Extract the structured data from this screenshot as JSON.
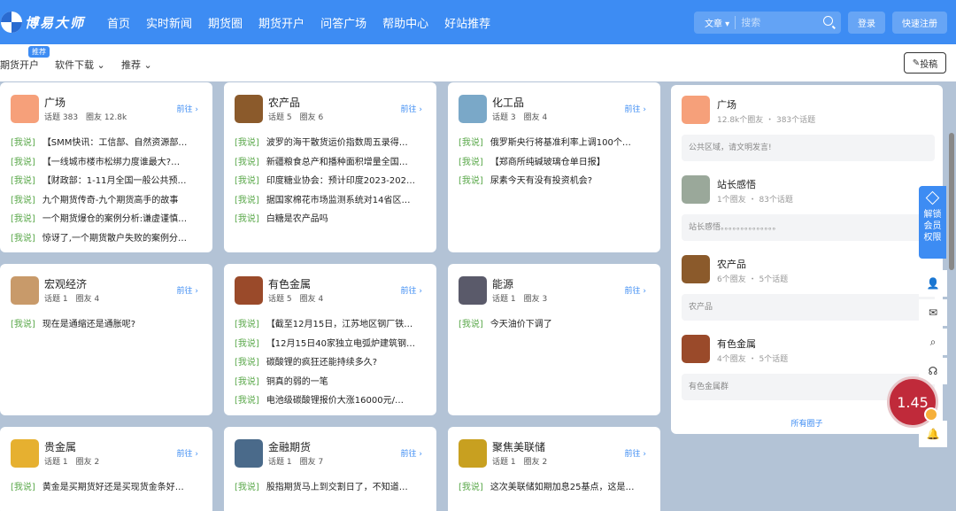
{
  "header": {
    "logo_text": "博易大师",
    "nav": [
      "首页",
      "实时新闻",
      "期货圈",
      "期货开户",
      "问答广场",
      "帮助中心",
      "好站推荐"
    ],
    "search": {
      "type": "文章",
      "placeholder": "搜索"
    },
    "login": "登录",
    "register": "快速注册"
  },
  "subnav": {
    "items": [
      "期货开户",
      "软件下载",
      "推荐"
    ],
    "badge": "推荐",
    "post_button": "投稿"
  },
  "cards": [
    {
      "title": "广场",
      "meta": "话题 383　圈友 12.8k",
      "go": "前往",
      "color": "#f6a07a",
      "posts": [
        "【SMM快讯：工信部、自然资源部…",
        "【一线城市楼市松绑力度谁最大?…",
        "【财政部：1-11月全国一般公共预…",
        "九个期货传奇-九个期货高手的故事",
        "一个期货爆仓的案例分析:谦虚谨慎…",
        "惊讶了,一个期货散户失败的案例分…"
      ]
    },
    {
      "title": "农产品",
      "meta": "话题 5　圈友 6",
      "go": "前往",
      "color": "#8b5a2b",
      "posts": [
        "波罗的海干散货运价指数周五录得…",
        "新疆粮食总产和播种面积增量全国…",
        "印度糖业协会：预计印度2023-202…",
        "据国家棉花市场监测系统对14省区…",
        "白糖是农产品吗"
      ]
    },
    {
      "title": "化工品",
      "meta": "话题 3　圈友 4",
      "go": "前往",
      "color": "#7aa8c8",
      "posts": [
        "俄罗斯央行将基准利率上调100个…",
        "【郑商所纯碱玻璃仓单日报】",
        "尿素今天有没有投资机会?"
      ]
    },
    {
      "title": "宏观经济",
      "meta": "话题 1　圈友 4",
      "go": "前往",
      "color": "#c89a6a",
      "posts": [
        "现在是通缩还是通胀呢?"
      ]
    },
    {
      "title": "有色金属",
      "meta": "话题 5　圈友 4",
      "go": "前往",
      "color": "#9a4a2a",
      "posts": [
        "【截至12月15日，江苏地区钢厂铁…",
        "【12月15日40家独立电弧炉建筑钢…",
        "碳酸锂的疯狂还能持续多久?",
        "铜真的弱的一笔",
        "电池级碳酸锂报价大涨16000元/…"
      ]
    },
    {
      "title": "能源",
      "meta": "话题 1　圈友 3",
      "go": "前往",
      "color": "#5a5a6a",
      "posts": [
        "今天油价下调了"
      ]
    },
    {
      "title": "贵金属",
      "meta": "话题 1　圈友 2",
      "go": "前往",
      "color": "#e6b030",
      "posts": [
        "黄金是买期货好还是买现货金条好…"
      ]
    },
    {
      "title": "金融期货",
      "meta": "话题 1　圈友 7",
      "go": "前往",
      "color": "#4a6a8a",
      "posts": [
        "股指期货马上到交割日了，不知道…"
      ]
    },
    {
      "title": "聚焦美联储",
      "meta": "话题 1　圈友 2",
      "go": "前往",
      "color": "#c8a020",
      "posts": [
        "这次美联储如期加息25基点，这是…"
      ]
    }
  ],
  "post_tag": "[我说]",
  "right_panel": {
    "groups": [
      {
        "name": "广场",
        "meta": "12.8k个圈友 ・ 383个话题",
        "desc": "公共区域，请文明发言!",
        "color": "#f6a07a"
      },
      {
        "name": "站长感悟",
        "meta": "1个圈友 ・ 83个话题",
        "desc": "站长感悟。。。。。。。。。。。。。。",
        "color": "#9aa89a"
      },
      {
        "name": "农产品",
        "meta": "6个圈友 ・ 5个话题",
        "desc": "农产品",
        "color": "#8b5a2b"
      },
      {
        "name": "有色金属",
        "meta": "4个圈友 ・ 5个话题",
        "desc": "有色金属群",
        "color": "#9a4a2a"
      }
    ],
    "all_link": "所有圈子"
  },
  "sidebar": {
    "vip": "解锁会员权限"
  },
  "price_widget": "1.45"
}
